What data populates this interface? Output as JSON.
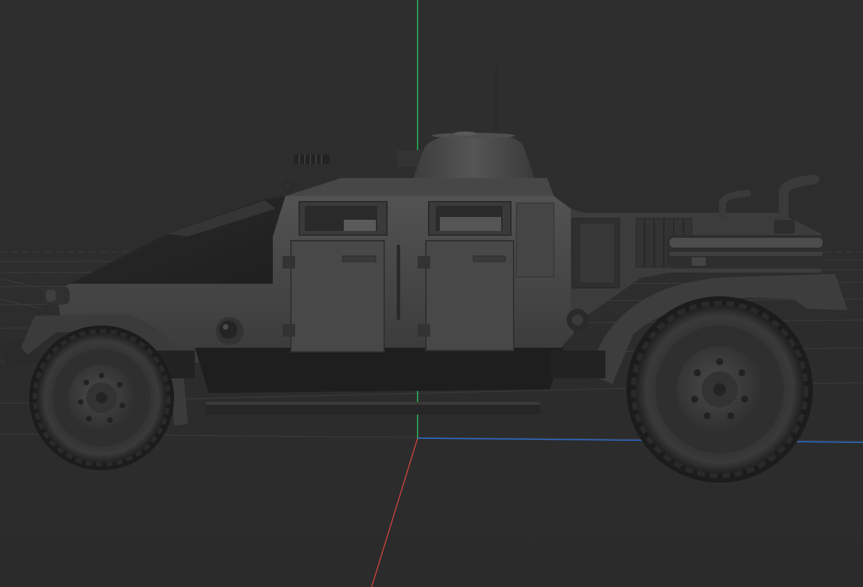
{
  "viewport": {
    "background": "#2c2c2c",
    "grid_color": "#3d3d3d",
    "axes": {
      "x_color": "#2b6fd8",
      "y_color": "#2bbf5a",
      "z_color": "#c8423a"
    }
  },
  "model": {
    "shading": "matcap-gray",
    "base_color": "#4a4a4a"
  }
}
